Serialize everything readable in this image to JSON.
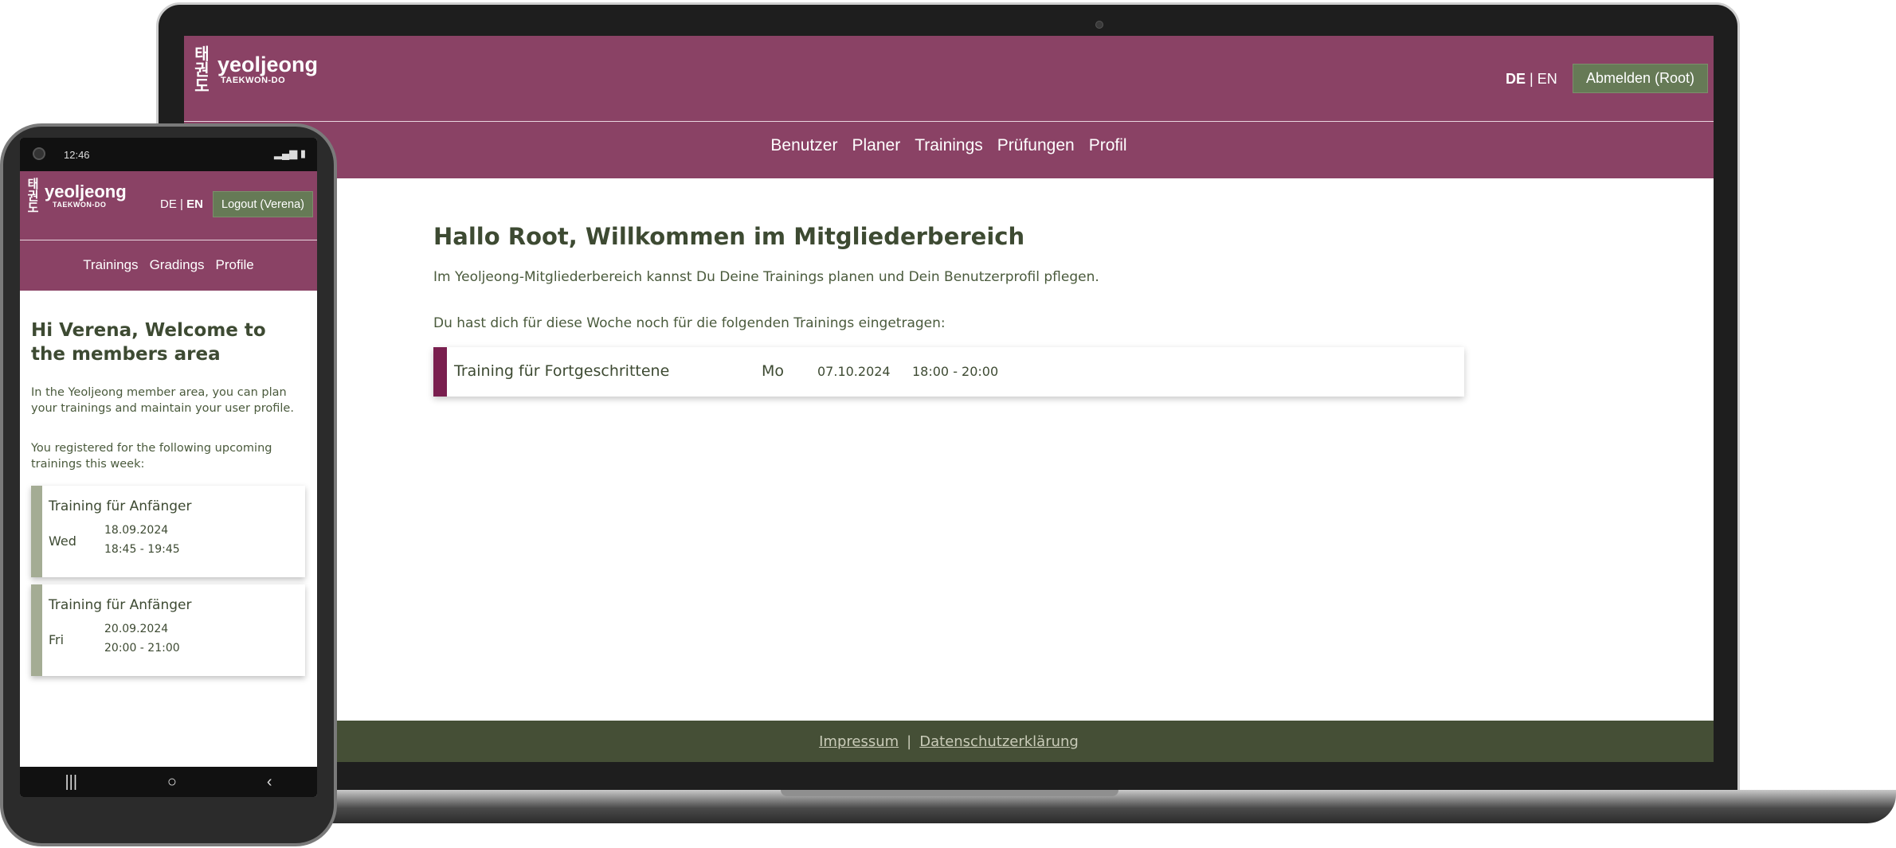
{
  "laptop": {
    "logo": {
      "emblem": "태권도",
      "word": "yeoljeong",
      "sub": "TAEKWON-DO"
    },
    "lang": {
      "de": "DE",
      "sep": "|",
      "en": "EN",
      "active": "DE"
    },
    "logout_label": "Abmelden (Root)",
    "nav": [
      "Benutzer",
      "Planer",
      "Trainings",
      "Prüfungen",
      "Profil"
    ],
    "heading": "Hallo Root, Willkommen im Mitgliederbereich",
    "intro": "Im Yeoljeong-Mitgliederbereich kannst Du Deine Trainings planen und Dein Benutzerprofil pflegen.",
    "registered_text": "Du hast dich für diese Woche noch für die folgenden Trainings eingetragen:",
    "trainings": [
      {
        "title": "Training für Fortgeschrittene",
        "day": "Mo",
        "date": "07.10.2024",
        "time": "18:00 - 20:00"
      }
    ],
    "footer": {
      "impressum": "Impressum",
      "sep": "|",
      "privacy": "Datenschutzerklärung"
    }
  },
  "phone": {
    "status_time": "12:46",
    "status_icons": "▂▄▆ ▮",
    "logo": {
      "emblem": "태권도",
      "word": "yeoljeong",
      "sub": "TAEKWON-DO"
    },
    "lang": {
      "de": "DE",
      "sep": "|",
      "en": "EN",
      "active": "EN"
    },
    "logout_label": "Logout (Verena)",
    "nav": [
      "Trainings",
      "Gradings",
      "Profile"
    ],
    "heading": "Hi Verena, Welcome to the members area",
    "intro": "In the Yeoljeong member area, you can plan your trainings and maintain your user profile.",
    "registered_text": "You registered for the following upcoming trainings this week:",
    "trainings": [
      {
        "title": "Training für Anfänger",
        "day": "Wed",
        "date": "18.09.2024",
        "time": "18:45 - 19:45"
      },
      {
        "title": "Training für Anfänger",
        "day": "Fri",
        "date": "20.09.2024",
        "time": "20:00 - 21:00"
      }
    ],
    "bottom_nav": {
      "recent": "|||",
      "home": "○",
      "back": "‹"
    }
  },
  "colors": {
    "header": "#8a4265",
    "footer": "#454f36",
    "button": "#667a56",
    "stripe_laptop": "#7a1f4f",
    "stripe_phone": "#a4ac94",
    "text": "#3d4a32"
  }
}
